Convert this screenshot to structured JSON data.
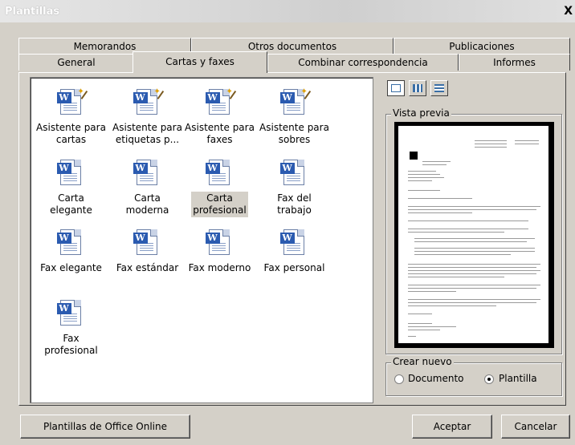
{
  "window": {
    "title": "Plantillas",
    "close_label": "X"
  },
  "tabs": {
    "row1": [
      "Memorandos",
      "Otros documentos",
      "Publicaciones"
    ],
    "row2": [
      "General",
      "Cartas y faxes",
      "Combinar correspondencia",
      "Informes"
    ],
    "active": "Cartas y faxes"
  },
  "templates": [
    {
      "line1": "Asistente para",
      "line2": "cartas",
      "icon": "word-wizard-icon"
    },
    {
      "line1": "Asistente para",
      "line2": "etiquetas p...",
      "icon": "word-wizard-icon"
    },
    {
      "line1": "Asistente para",
      "line2": "faxes",
      "icon": "word-wizard-icon"
    },
    {
      "line1": "Asistente para",
      "line2": "sobres",
      "icon": "word-wizard-icon"
    },
    {
      "line1": "Carta",
      "line2": "elegante",
      "icon": "word-document-icon"
    },
    {
      "line1": "Carta",
      "line2": "moderna",
      "icon": "word-document-icon"
    },
    {
      "line1": "Carta",
      "line2": "profesional",
      "icon": "word-document-icon",
      "selected": true
    },
    {
      "line1": "Fax del",
      "line2": "trabajo",
      "icon": "word-document-icon"
    },
    {
      "line1": "Fax elegante",
      "line2": "",
      "icon": "word-document-icon"
    },
    {
      "line1": "Fax estándar",
      "line2": "",
      "icon": "word-document-icon"
    },
    {
      "line1": "Fax moderno",
      "line2": "",
      "icon": "word-document-icon"
    },
    {
      "line1": "Fax personal",
      "line2": "",
      "icon": "word-document-icon"
    },
    {
      "line1": "Fax",
      "line2": "profesional",
      "icon": "word-document-icon"
    }
  ],
  "view_buttons": [
    "large-icons-view-icon",
    "list-view-icon",
    "details-view-icon"
  ],
  "preview": {
    "legend": "Vista previa"
  },
  "create_new": {
    "legend": "Crear nuevo",
    "options": [
      "Documento",
      "Plantilla"
    ],
    "selected": "Plantilla"
  },
  "buttons": {
    "office_online": "Plantillas de Office Online",
    "accept": "Aceptar",
    "cancel": "Cancelar"
  }
}
